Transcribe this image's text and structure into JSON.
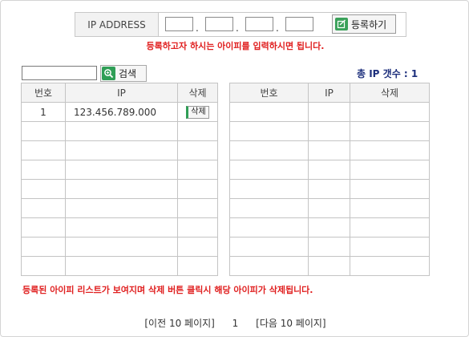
{
  "ip_form": {
    "label": "IP ADDRESS",
    "octets": [
      "",
      "",
      "",
      ""
    ],
    "separator": ".",
    "register_label": "등록하기",
    "register_icon": "register-icon",
    "hint": "등록하고자 하시는 아이피를 입력하시면 됩니다."
  },
  "search": {
    "value": "",
    "button_label": "검색",
    "button_icon": "magnifier-icon"
  },
  "summary": {
    "count_text": "총 IP 갯수 : 1"
  },
  "table_left": {
    "headers": {
      "no": "번호",
      "ip": "IP",
      "delete": "삭제"
    },
    "rows": [
      {
        "no": "1",
        "ip": "123.456.789.000",
        "delete_label": "삭제"
      },
      {
        "no": "",
        "ip": "",
        "delete_label": ""
      },
      {
        "no": "",
        "ip": "",
        "delete_label": ""
      },
      {
        "no": "",
        "ip": "",
        "delete_label": ""
      },
      {
        "no": "",
        "ip": "",
        "delete_label": ""
      },
      {
        "no": "",
        "ip": "",
        "delete_label": ""
      },
      {
        "no": "",
        "ip": "",
        "delete_label": ""
      },
      {
        "no": "",
        "ip": "",
        "delete_label": ""
      },
      {
        "no": "",
        "ip": "",
        "delete_label": ""
      }
    ]
  },
  "table_right": {
    "headers": {
      "no": "번호",
      "ip": "IP",
      "delete": "삭제"
    },
    "rows": [
      {
        "no": "",
        "ip": "",
        "delete_label": ""
      },
      {
        "no": "",
        "ip": "",
        "delete_label": ""
      },
      {
        "no": "",
        "ip": "",
        "delete_label": ""
      },
      {
        "no": "",
        "ip": "",
        "delete_label": ""
      },
      {
        "no": "",
        "ip": "",
        "delete_label": ""
      },
      {
        "no": "",
        "ip": "",
        "delete_label": ""
      },
      {
        "no": "",
        "ip": "",
        "delete_label": ""
      },
      {
        "no": "",
        "ip": "",
        "delete_label": ""
      },
      {
        "no": "",
        "ip": "",
        "delete_label": ""
      }
    ]
  },
  "list_hint": "등록된 아이피 리스트가 보여지며 삭제 버튼 클릭시 해당 아이피가 삭제됩니다.",
  "pagination": {
    "prev_label": "[이전 10 페이지]",
    "current_page": "1",
    "next_label": "[다음 10 페이지]"
  },
  "colors": {
    "warning_text": "#e02020",
    "count_text": "#1d2f7c",
    "icon_green": "#2f9e56",
    "border": "#c4c4c4",
    "header_bg": "#f3f3f3"
  }
}
